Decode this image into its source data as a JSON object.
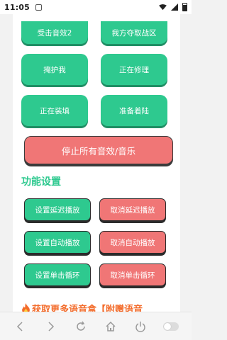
{
  "status_bar": {
    "time": "11:05"
  },
  "sound_buttons": [
    {
      "label": "受击音效2"
    },
    {
      "label": "我方夺取战区"
    },
    {
      "label": "掩护我"
    },
    {
      "label": "正在修理"
    },
    {
      "label": "正在装填"
    },
    {
      "label": "准备着陆"
    }
  ],
  "stop_all": {
    "label": "停止所有音效/音乐"
  },
  "settings": {
    "title": "功能设置",
    "buttons": [
      {
        "label": "设置延迟播放",
        "tone": "green"
      },
      {
        "label": "取消延迟播放",
        "tone": "red"
      },
      {
        "label": "设置自动播放",
        "tone": "green"
      },
      {
        "label": "取消自动播放",
        "tone": "red"
      },
      {
        "label": "设置单击循环",
        "tone": "green"
      },
      {
        "label": "取消单击循环",
        "tone": "red"
      }
    ]
  },
  "promo": {
    "text": "获取更多语音盒【附赠语音"
  },
  "colors": {
    "green": "#2ec98f",
    "red": "#f07676",
    "promo": "#f36b2a"
  },
  "nav_icons": [
    "back-icon",
    "forward-icon",
    "refresh-icon",
    "home-icon",
    "power-icon",
    "toggle-switch"
  ]
}
